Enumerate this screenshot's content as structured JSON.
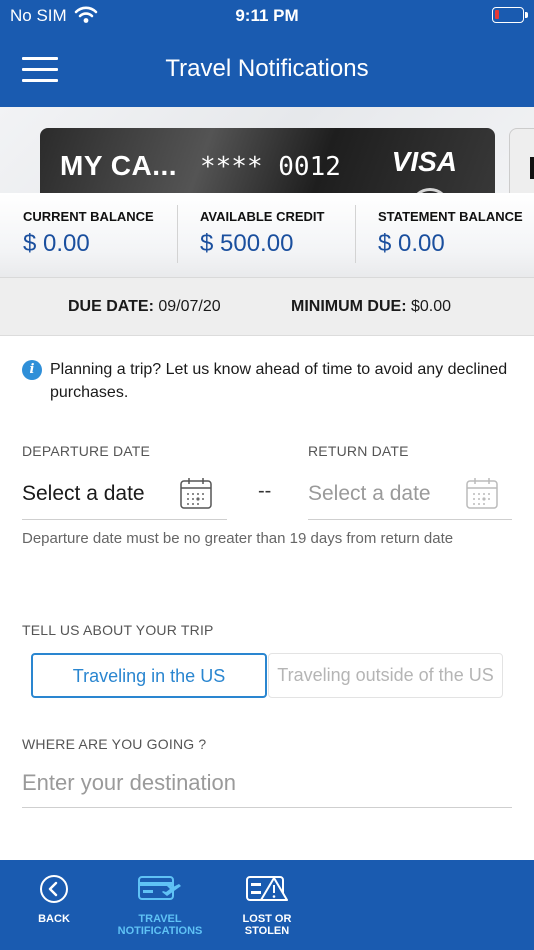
{
  "status_bar": {
    "carrier": "No SIM",
    "time": "9:11 PM",
    "battery_icon": "battery-low-icon",
    "wifi_icon": "wifi-icon"
  },
  "header": {
    "title": "Travel Notifications",
    "menu_icon": "hamburger-menu-icon"
  },
  "card": {
    "name": "MY CA...",
    "number": "**** 0012",
    "brand": "VISA"
  },
  "balances": [
    {
      "label": "CURRENT BALANCE",
      "value": "$ 0.00"
    },
    {
      "label": "AVAILABLE CREDIT",
      "value": "$ 500.00"
    },
    {
      "label": "STATEMENT BALANCE",
      "value": "$ 0.00"
    }
  ],
  "due": {
    "due_label": "DUE DATE:",
    "due_value": "09/07/20",
    "min_label": "MINIMUM DUE:",
    "min_value": "$0.00"
  },
  "info": {
    "icon": "info-icon",
    "text": "Planning a trip? Let us know ahead of time to avoid any declined purchases."
  },
  "departure": {
    "label": "DEPARTURE DATE",
    "value": "Select a date"
  },
  "separator": "--",
  "return_date": {
    "label": "RETURN DATE",
    "placeholder": "Select a date"
  },
  "date_hint": "Departure date must be no greater than 19 days from return date",
  "trip": {
    "label": "TELL US ABOUT YOUR TRIP",
    "options": [
      "Traveling in the US",
      "Traveling outside of the US"
    ],
    "selected": "Traveling in the US"
  },
  "destination": {
    "label": "WHERE ARE YOU GOING ?",
    "placeholder": "Enter your destination"
  },
  "tabs": {
    "back": {
      "line1": "BACK",
      "line2": ""
    },
    "travel": {
      "line1": "TRAVEL",
      "line2": "NOTIFICATIONS"
    },
    "lost": {
      "line1": "LOST OR",
      "line2": "STOLEN"
    }
  },
  "colors": {
    "primary": "#1a5bb0",
    "accent": "#2a86d0",
    "tab_active": "#5fc2f5",
    "balance_value": "#1a4f9e"
  }
}
